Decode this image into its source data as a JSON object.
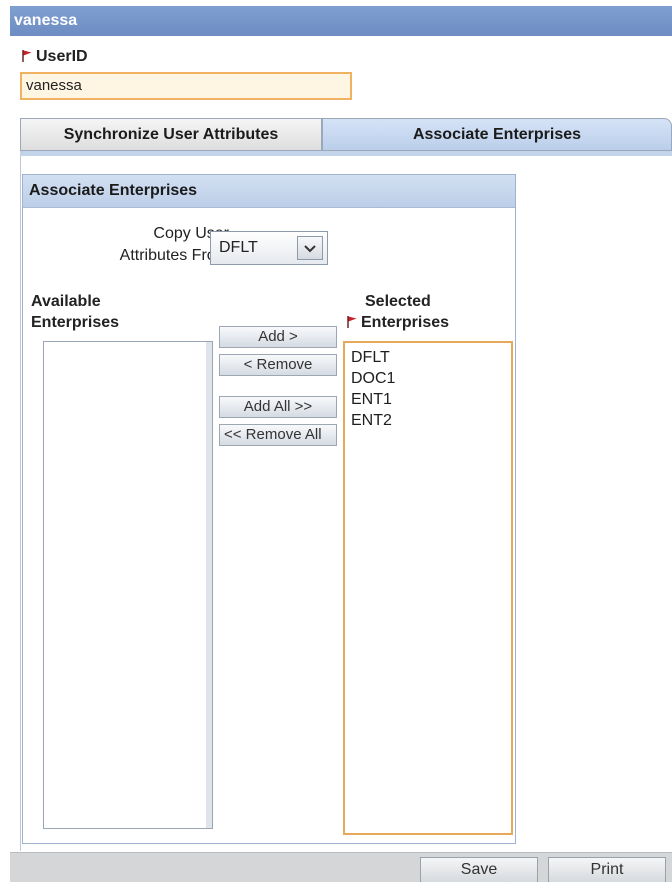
{
  "window": {
    "title": "vanessa"
  },
  "user": {
    "userid_label": "UserID",
    "userid_value": "vanessa"
  },
  "tabs": [
    {
      "label": "Synchronize User Attributes",
      "active": false
    },
    {
      "label": "Associate Enterprises",
      "active": true
    }
  ],
  "panel": {
    "title": "Associate Enterprises",
    "copy_label_line1": "Copy User",
    "copy_label_line2": "Attributes From",
    "copy_selected": "DFLT",
    "available": {
      "label_line1": "Available",
      "label_line2": "Enterprises",
      "items": []
    },
    "selected": {
      "label_line1": "Selected",
      "label_line2": "Enterprises",
      "items": [
        "DFLT",
        "DOC1",
        "ENT1",
        "ENT2"
      ]
    },
    "buttons": {
      "add": "Add >",
      "remove": "< Remove",
      "add_all": "Add All >>",
      "remove_all": "<< Remove All"
    }
  },
  "footer": {
    "save": "Save",
    "print": "Print"
  },
  "colors": {
    "titlebar": "#7f9fd0",
    "required_flag": "#c8202a",
    "input_highlight_border": "#f0b261"
  },
  "icons": {
    "required": "red-flag-icon",
    "dropdown": "chevron-down-icon"
  }
}
